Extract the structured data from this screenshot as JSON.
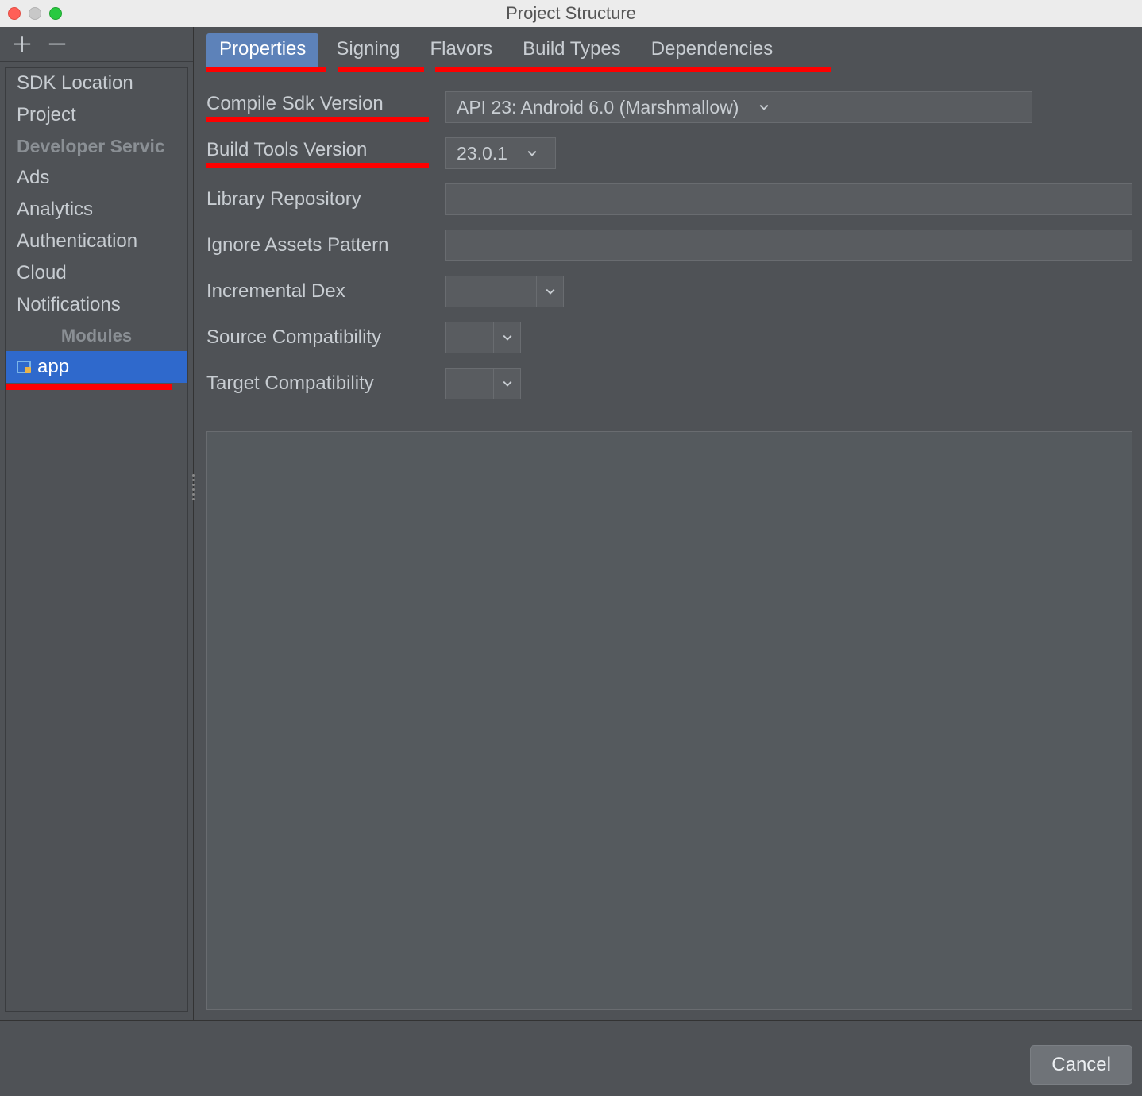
{
  "window": {
    "title": "Project Structure"
  },
  "sidebar": {
    "items": [
      "SDK Location",
      "Project"
    ],
    "dev_section_label": "Developer Servic",
    "dev_items": [
      "Ads",
      "Analytics",
      "Authentication",
      "Cloud",
      "Notifications"
    ],
    "modules_label": "Modules",
    "module_name": "app"
  },
  "tabs": {
    "items": [
      "Properties",
      "Signing",
      "Flavors",
      "Build Types",
      "Dependencies"
    ],
    "active": 0
  },
  "form": {
    "compile_sdk_label": "Compile Sdk Version",
    "compile_sdk_value": "API 23: Android 6.0 (Marshmallow)",
    "build_tools_label": "Build Tools Version",
    "build_tools_value": "23.0.1",
    "library_repo_label": "Library Repository",
    "library_repo_value": "",
    "ignore_assets_label": "Ignore Assets Pattern",
    "ignore_assets_value": "",
    "incremental_dex_label": "Incremental Dex",
    "incremental_dex_value": "",
    "source_compat_label": "Source Compatibility",
    "source_compat_value": "",
    "target_compat_label": "Target Compatibility",
    "target_compat_value": ""
  },
  "footer": {
    "cancel_label": "Cancel"
  }
}
